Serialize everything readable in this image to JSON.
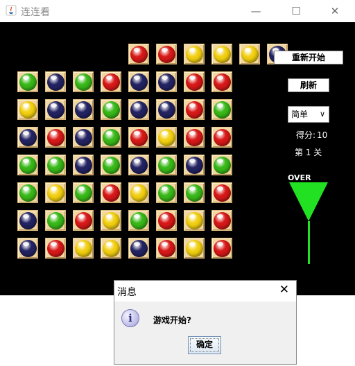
{
  "window": {
    "title": "连连看",
    "minimize_glyph": "—",
    "maximize_glyph": "☐",
    "close_glyph": "✕"
  },
  "colors": {
    "R": "#d81818",
    "G": "#38b818",
    "B": "#232363",
    "Y": "#f2cf10",
    "tile": "#f0d6a0",
    "timer": "#22e022"
  },
  "board": {
    "rows": [
      "....RRYYYB",
      "GBGRBBRR",
      "YBBGBBRG",
      "BRBGRYRR",
      "GGBGBGBG",
      "GYGRYGGR",
      "BGRYGRYR",
      "BRYYBRYR"
    ]
  },
  "panel": {
    "restart_label": "重新开始",
    "refresh_label": "刷新",
    "difficulty": "简单",
    "score_label": "得分:",
    "score_value": "10",
    "level_label": "第 1 关",
    "over_label": "OVER"
  },
  "dialog": {
    "title": "消息",
    "message": "游戏开始?",
    "ok_label": "确定",
    "close_glyph": "✕",
    "info_glyph": "i"
  }
}
